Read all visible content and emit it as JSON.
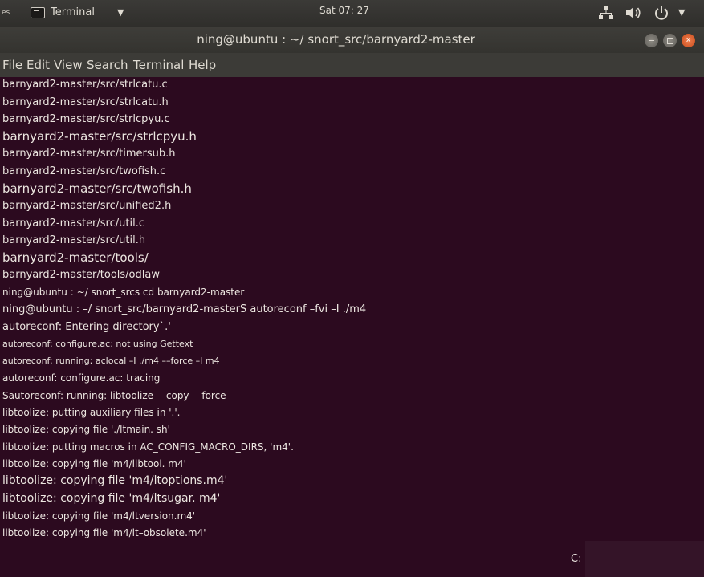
{
  "top_panel": {
    "activities": "es",
    "app_name": "Terminal",
    "clock": "Sat 07: 27"
  },
  "window": {
    "title": "ning@ubuntu : ~/ snort_src/barnyard2-master",
    "close_label": "x"
  },
  "menu": {
    "items": [
      "File",
      "Edit",
      "View",
      "Search",
      "Terminal",
      "Help"
    ]
  },
  "terminal": {
    "lines": [
      "barnyard2-master/src/strlcatu.c",
      "barnyard2-master/src/strlcatu.h",
      "barnyard2-master/src/strlcpyu.c",
      "barnyard2-master/src/strlcpyu.h",
      "barnyard2-master/src/timersub.h",
      "barnyard2-master/src/twofish.c",
      "barnyard2-master/src/twofish.h",
      "barnyard2-master/src/unified2.h",
      "barnyard2-master/src/util.c",
      "barnyard2-master/src/util.h",
      "barnyard2-master/tools/",
      "barnyard2-master/tools/odlaw",
      "ning@ubuntu : ~/ snort_srcs cd barnyard2-master",
      "ning@ubuntu : –/ snort_src/barnyard2-masterS autoreconf –fvi –I ./m4",
      "autoreconf: Entering directory`.'",
      "autoreconf: configure.ac: not using Gettext",
      "autoreconf: running: aclocal –I ./m4 ––force –I m4",
      "autoreconf: configure.ac: tracing",
      "Sautoreconf: running: libtoolize ––copy ––force",
      "libtoolize: putting auxiliary files in '.'.",
      "libtoolize: copying file './ltmain. sh'",
      "libtoolize: putting macros in AC_CONFIG_MACRO_DIRS, 'm4'.",
      "libtoolize: copying file 'm4/libtool. m4'",
      "libtoolize: copying file 'm4/ltoptions.m4'",
      "libtoolize: copying file 'm4/ltsugar. m4'",
      "libtoolize: copying file 'm4/ltversion.m4'",
      "libtoolize: copying file 'm4/lt–obsolete.m4'"
    ],
    "trailing": "C:"
  }
}
